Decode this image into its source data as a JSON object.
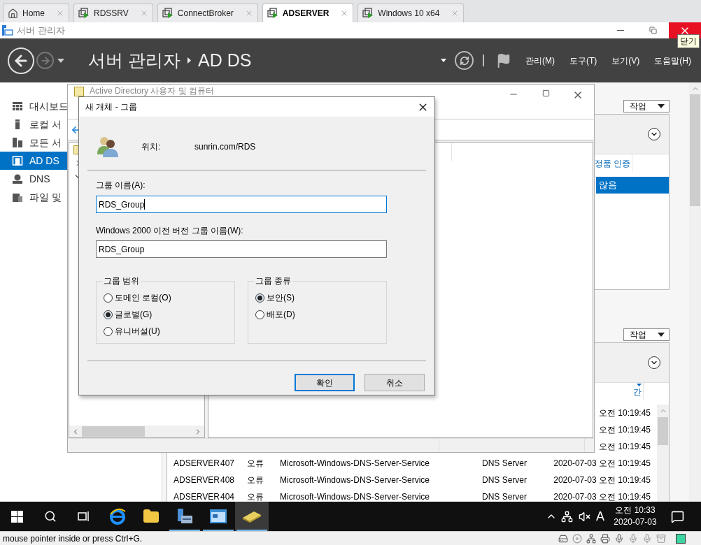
{
  "vm_tabs": [
    {
      "label": "Home",
      "kind": "home",
      "selected": false
    },
    {
      "label": "RDSSRV",
      "kind": "vm",
      "selected": false
    },
    {
      "label": "ConnectBroker",
      "kind": "vm",
      "selected": false
    },
    {
      "label": "ADSERVER",
      "kind": "vm",
      "selected": true
    },
    {
      "label": "Windows 10 x64",
      "kind": "vm",
      "selected": false
    }
  ],
  "app_window": {
    "title": "서버 관리자",
    "tooltip": "닫기"
  },
  "header": {
    "breadcrumb": [
      "서버 관리자",
      "AD DS"
    ],
    "menus": [
      "관리(M)",
      "도구(T)",
      "보기(V)",
      "도움말(H)"
    ]
  },
  "sidebar": {
    "items": [
      {
        "label": "대시보드",
        "kind": "dashboard",
        "selected": false
      },
      {
        "label": "로컬 서",
        "kind": "server",
        "selected": false
      },
      {
        "label": "모든 서",
        "kind": "servers",
        "selected": false
      },
      {
        "label": "AD DS",
        "kind": "adds",
        "selected": true
      },
      {
        "label": "DNS",
        "kind": "dns",
        "selected": false
      },
      {
        "label": "파일 및",
        "kind": "files",
        "selected": false
      }
    ]
  },
  "panels": [
    {
      "tasks_label": "작업",
      "column": "정품 인증",
      "rows": [
        {
          "date": "않음",
          "selected": true
        }
      ]
    },
    {
      "tasks_label": "작업",
      "column": "간",
      "rows": [
        {
          "date": "오전 10:19:45"
        },
        {
          "date": "오전 10:19:45"
        },
        {
          "date": "오전 10:19:45"
        },
        {
          "server": "ADSERVER",
          "id": "407",
          "severity": "오류",
          "source": "Microsoft-Windows-DNS-Server-Service",
          "category": "DNS Server",
          "date": "2020-07-03 오전 10:19:45"
        },
        {
          "server": "ADSERVER",
          "id": "408",
          "severity": "오류",
          "source": "Microsoft-Windows-DNS-Server-Service",
          "category": "DNS Server",
          "date": "2020-07-03 오전 10:19:45"
        },
        {
          "server": "ADSERVER",
          "id": "404",
          "severity": "오류",
          "source": "Microsoft-Windows-DNS-Server-Service",
          "category": "DNS Server",
          "date": "2020-07-03 오전 10:19:45"
        }
      ]
    }
  ],
  "aduc_window": {
    "title": "Active Directory 사용자 및 컴퓨터"
  },
  "dialog": {
    "title": "새 개체 - 그룹",
    "location_label": "위치:",
    "location": "sunrin.com/RDS",
    "name_label": "그룹 이름(A):",
    "name_value": "RDS_Group",
    "legacy_label": "Windows 2000 이전 버전 그룹 이름(W):",
    "legacy_value": "RDS_Group",
    "groups": [
      {
        "title": "그룹 범위",
        "options": [
          {
            "label": "도메인 로컬(O)",
            "selected": false
          },
          {
            "label": "글로벌(G)",
            "selected": true
          },
          {
            "label": "유니버설(U)",
            "selected": false
          }
        ]
      },
      {
        "title": "그룹 종류",
        "options": [
          {
            "label": "보안(S)",
            "selected": true
          },
          {
            "label": "배포(D)",
            "selected": false
          }
        ]
      }
    ],
    "buttons": [
      {
        "label": "확인",
        "kind": "default"
      },
      {
        "label": "취소",
        "kind": "normal"
      }
    ]
  },
  "taskbar": {
    "apps": [
      {
        "kind": "browser",
        "open": false,
        "selected": false
      },
      {
        "kind": "folder",
        "open": false,
        "selected": false
      },
      {
        "kind": "server-manager",
        "open": true,
        "selected": false
      },
      {
        "kind": "console",
        "open": true,
        "selected": false
      },
      {
        "kind": "tool",
        "open": true,
        "selected": true
      }
    ],
    "input_indicator": "A",
    "time": "오전 10:33",
    "date": "2020-07-03"
  },
  "vm_status": {
    "text": "mouse pointer inside or press Ctrl+G."
  }
}
